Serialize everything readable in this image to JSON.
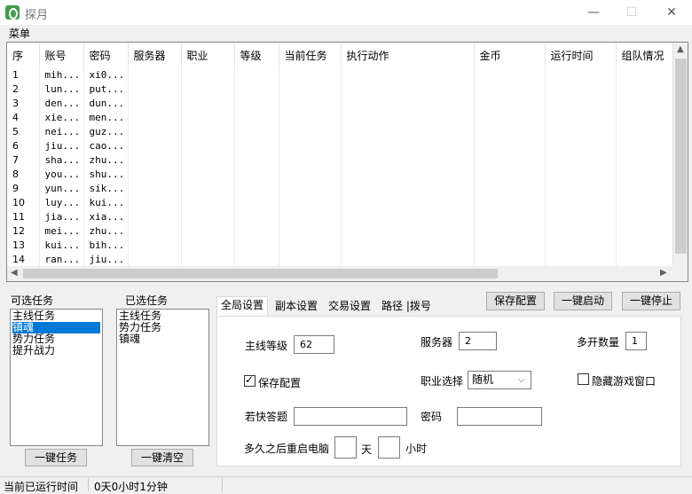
{
  "window": {
    "title": "探月",
    "minimize": "—",
    "maximize": "☐",
    "close": "✕"
  },
  "menu": {
    "label": "菜单"
  },
  "table": {
    "columns": [
      "序",
      "账号",
      "密码",
      "服务器",
      "职业",
      "等级",
      "当前任务",
      "执行动作",
      "金币",
      "运行时间",
      "组队情况"
    ],
    "rows": [
      [
        "1",
        "mih...",
        "xi0..."
      ],
      [
        "2",
        "lun...",
        "put..."
      ],
      [
        "3",
        "den...",
        "dun..."
      ],
      [
        "4",
        "xie...",
        "men..."
      ],
      [
        "5",
        "nei...",
        "guz..."
      ],
      [
        "6",
        "jiu...",
        "cao..."
      ],
      [
        "7",
        "sha...",
        "zhu..."
      ],
      [
        "8",
        "you...",
        "shu..."
      ],
      [
        "9",
        "yun...",
        "sik..."
      ],
      [
        "10",
        "luy...",
        "kui..."
      ],
      [
        "11",
        "jia...",
        "xia..."
      ],
      [
        "12",
        "mei...",
        "zhu..."
      ],
      [
        "13",
        "kui...",
        "bih..."
      ],
      [
        "14",
        "ran...",
        "jiu..."
      ]
    ]
  },
  "available_tasks": {
    "label": "可选任务",
    "items": [
      "主线任务",
      "镇魂",
      "势力任务",
      "提升战力"
    ],
    "selected_index": 1,
    "button": "一键任务"
  },
  "selected_tasks": {
    "label": "已选任务",
    "items": [
      "主线任务",
      "势力任务",
      "镇魂"
    ],
    "button": "一键清空"
  },
  "toolbar": {
    "save": "保存配置",
    "start": "一键启动",
    "stop": "一键停止"
  },
  "tabs": [
    "全局设置",
    "副本设置",
    "交易设置",
    "路径 |拨号"
  ],
  "settings": {
    "main_level_label": "主线等级",
    "main_level_value": "62",
    "server_label": "服务器",
    "server_value": "2",
    "multi_count_label": "多开数量",
    "multi_count_value": "1",
    "save_config_label": "保存配置",
    "save_config_checked": true,
    "job_label": "职业选择",
    "job_value": "随机",
    "hide_window_label": "隐藏游戏窗口",
    "hide_window_checked": false,
    "quick_answer_label": "若快答题",
    "quick_answer_value": "",
    "password_label": "密码",
    "password_value": "",
    "restart_label": "多久之后重启电脑",
    "days_value": "",
    "days_unit": "天",
    "hours_value": "",
    "hours_unit": "小时"
  },
  "status": {
    "label": "当前已运行时间",
    "value": "0天0小时1分钟"
  }
}
